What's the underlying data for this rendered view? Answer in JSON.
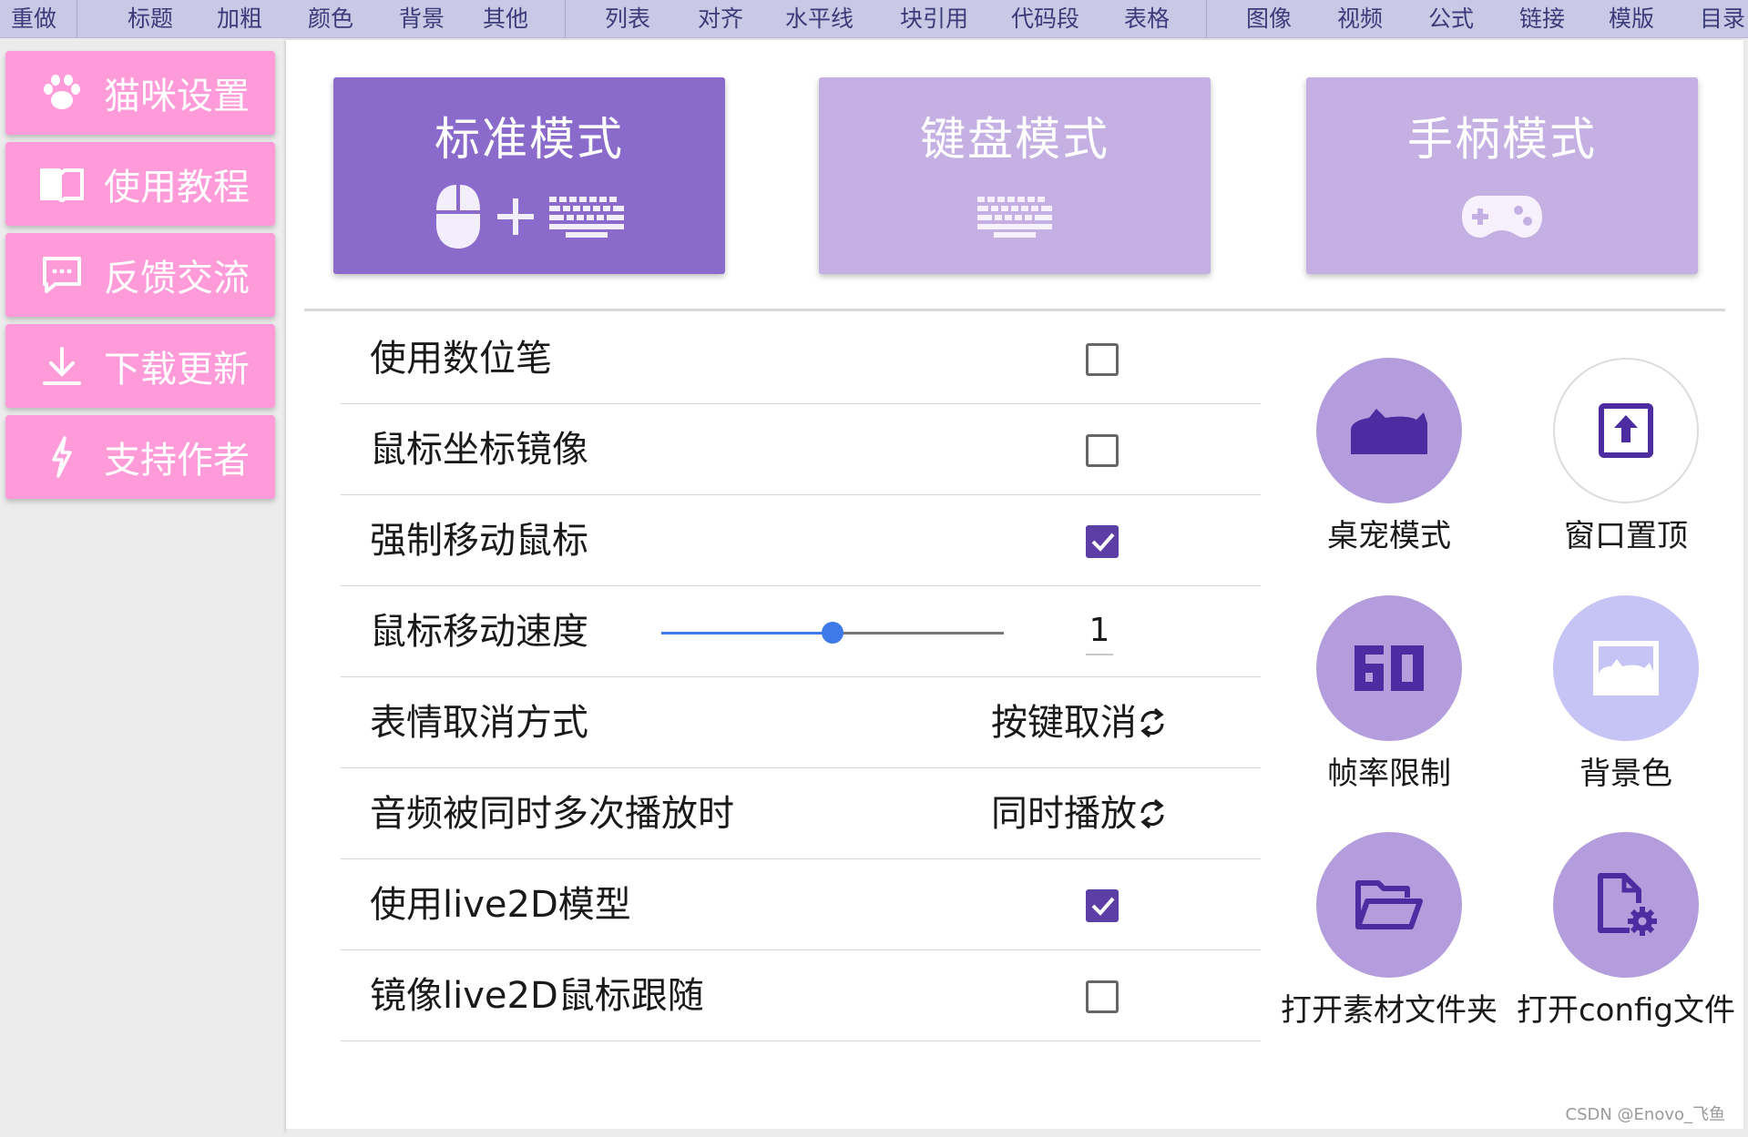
{
  "toolbar": {
    "items": [
      "重做",
      "标题",
      "加粗",
      "颜色",
      "背景",
      "其他",
      "列表",
      "对齐",
      "水平线",
      "块引用",
      "代码段",
      "表格",
      "图像",
      "视频",
      "公式",
      "链接",
      "模版",
      "目录"
    ]
  },
  "sidebar": {
    "items": [
      {
        "label": "猫咪设置",
        "icon": "paw-icon"
      },
      {
        "label": "使用教程",
        "icon": "book-icon"
      },
      {
        "label": "反馈交流",
        "icon": "chat-icon"
      },
      {
        "label": "下载更新",
        "icon": "download-icon"
      },
      {
        "label": "支持作者",
        "icon": "bolt-icon"
      }
    ]
  },
  "modes": [
    {
      "label": "标准模式",
      "active": true,
      "icons": [
        "mouse-icon",
        "plus-icon",
        "keyboard-icon"
      ]
    },
    {
      "label": "键盘模式",
      "active": false,
      "icons": [
        "keyboard-icon"
      ]
    },
    {
      "label": "手柄模式",
      "active": false,
      "icons": [
        "gamepad-icon"
      ]
    }
  ],
  "settings": {
    "digital_pen": {
      "label": "使用数位笔",
      "checked": false
    },
    "mouse_mirror": {
      "label": "鼠标坐标镜像",
      "checked": false
    },
    "force_move": {
      "label": "强制移动鼠标",
      "checked": true
    },
    "mouse_speed": {
      "label": "鼠标移动速度",
      "value": "1",
      "slider_fraction": 0.5
    },
    "emoji_cancel": {
      "label": "表情取消方式",
      "value": "按键取消"
    },
    "audio_multi": {
      "label": "音频被同时多次播放时",
      "value": "同时播放"
    },
    "use_live2d": {
      "label": "使用live2D模型",
      "checked": true
    },
    "mirror_live2d": {
      "label": "镜像live2D鼠标跟随",
      "checked": false
    }
  },
  "tools": [
    {
      "label": "桌宠模式",
      "icon": "cat-silhouette-icon"
    },
    {
      "label": "窗口置顶",
      "icon": "window-top-icon"
    },
    {
      "label": "帧率限制",
      "icon": "fps-60-icon"
    },
    {
      "label": "背景色",
      "icon": "image-icon"
    },
    {
      "label": "打开素材文件夹",
      "icon": "folder-open-icon"
    },
    {
      "label": "打开config文件",
      "icon": "file-settings-icon"
    }
  ],
  "colors": {
    "sidebar_button": "#ff9bd9",
    "mode_active": "#8a6acb",
    "mode_inactive": "#c4b0e2",
    "accent": "#5b3ea6",
    "slider": "#3e7be8"
  },
  "watermark": "CSDN @Enovo_飞鱼"
}
